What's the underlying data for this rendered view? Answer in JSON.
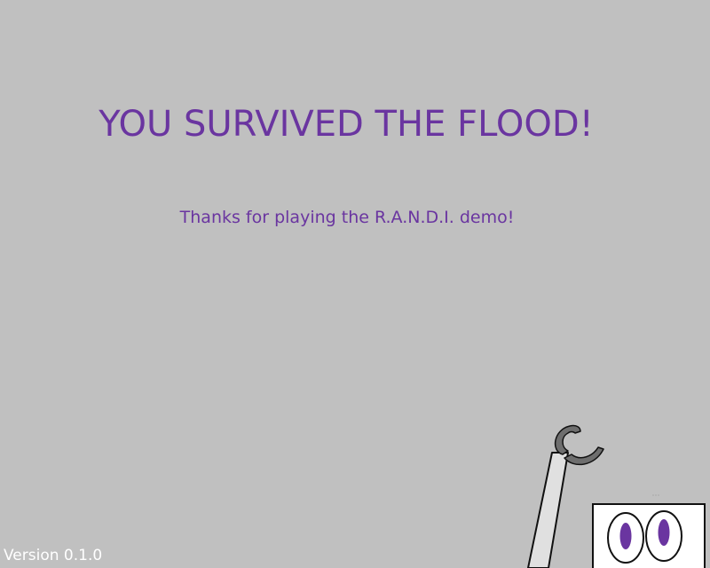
{
  "screen": {
    "title": "YOU SURVIVED THE FLOOD!",
    "subtitle": "Thanks for playing the R.A.N.D.I. demo!",
    "version": "Version 0.1.0"
  },
  "colors": {
    "background": "#c0c0c0",
    "accent_text": "#6a35a0",
    "version_text": "#ffffff",
    "robot_arm": "#e0e0e0",
    "robot_claw": "#6e6e6e",
    "robot_eye_pupil": "#6a35a0"
  },
  "icons": {
    "robot": "randi-robot-peek-icon"
  }
}
